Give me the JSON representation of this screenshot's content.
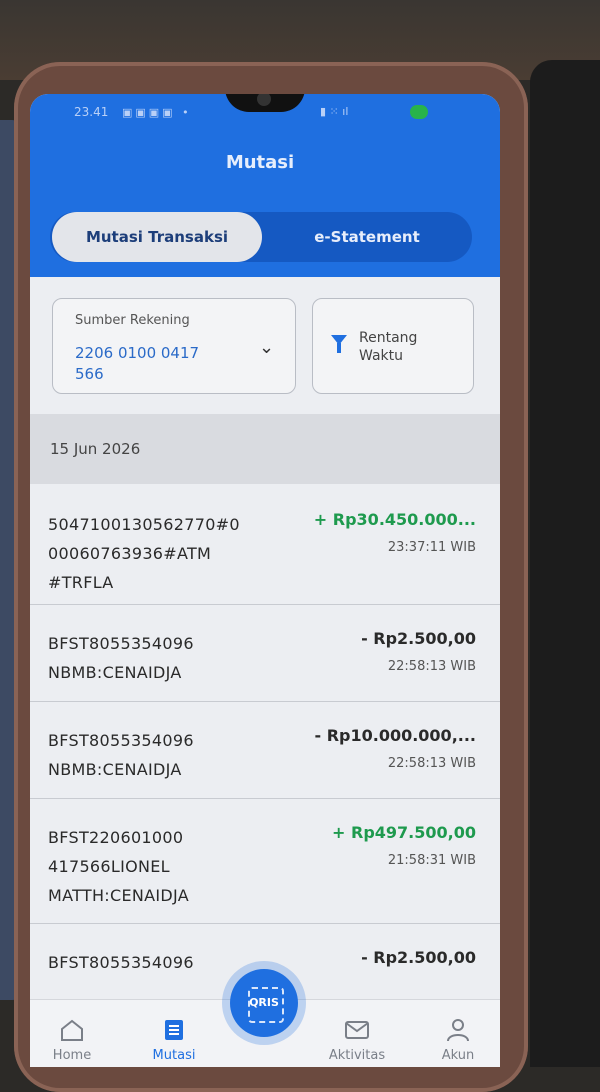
{
  "status_bar": {
    "time": "23.41"
  },
  "header": {
    "title": "Mutasi"
  },
  "tabs": [
    {
      "label": "Mutasi Transaksi",
      "active": true
    },
    {
      "label": "e-Statement",
      "active": false
    }
  ],
  "source_account": {
    "label": "Sumber Rekening",
    "value": "2206 0100 0417 566"
  },
  "date_range": {
    "label": "Rentang Waktu"
  },
  "date_group": "15 Jun 2026",
  "transactions": [
    {
      "description": "5047100130562770#0 00060763936#ATM #TRFLA",
      "amount": "+ Rp30.450.000...",
      "time": "23:37:11 WIB",
      "type": "credit"
    },
    {
      "description": "BFST8055354096 NBMB:CENAIDJA",
      "amount": "- Rp2.500,00",
      "time": "22:58:13 WIB",
      "type": "debit"
    },
    {
      "description": "BFST8055354096 NBMB:CENAIDJA",
      "amount": "- Rp10.000.000,...",
      "time": "22:58:13 WIB",
      "type": "debit"
    },
    {
      "description": "BFST220601000 417566LIONEL MATTH:CENAIDJA",
      "amount": "+ Rp497.500,00",
      "time": "21:58:31 WIB",
      "type": "credit"
    },
    {
      "description": "BFST8055354096",
      "amount": "- Rp2.500,00",
      "time": "",
      "type": "debit"
    }
  ],
  "bottom_nav": [
    {
      "label": "Home",
      "icon": "home-icon",
      "active": false
    },
    {
      "label": "Mutasi",
      "icon": "receipt-icon",
      "active": true
    },
    {
      "label": "Aktivitas",
      "icon": "mail-icon",
      "active": false
    },
    {
      "label": "Akun",
      "icon": "user-icon",
      "active": false
    }
  ],
  "qris_button": {
    "label": "QRIS"
  },
  "colors": {
    "primary": "#1f6fe0",
    "credit": "#1e9a4e",
    "debit": "#2a2a2a"
  }
}
